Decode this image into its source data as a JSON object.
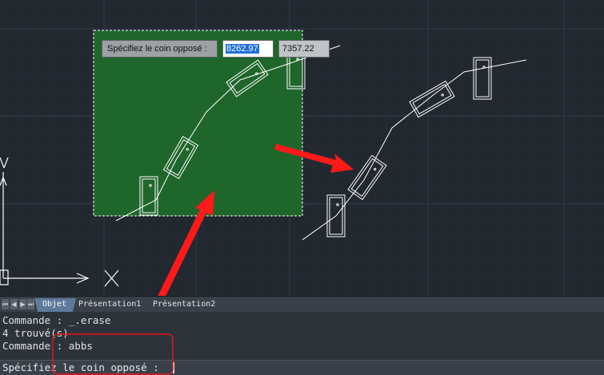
{
  "dynamic_input": {
    "prompt": "Spécifiez le coin opposé :",
    "x_value": "8262.97",
    "y_value": "7357.22"
  },
  "tabs": [
    {
      "label": "Objet",
      "active": true
    },
    {
      "label": "Présentation1",
      "active": false
    },
    {
      "label": "Présentation2",
      "active": false
    }
  ],
  "command_history": [
    "Commande : _.erase",
    "4 trouvé(s)",
    "Commande : abbs"
  ],
  "command_prompt": "Spécifiez le coin opposé :",
  "colors": {
    "canvas": "#212830",
    "selection_fill": "#1f6b2b",
    "annotation_arrow": "#ff1a1a",
    "geometry": "#ffffff"
  },
  "icons": {
    "nav_first": "⏮",
    "nav_prev": "◀",
    "nav_next": "▶",
    "nav_last": "⏭"
  }
}
